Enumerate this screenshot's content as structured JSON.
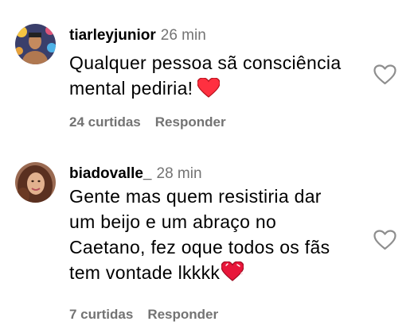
{
  "comments": [
    {
      "username": "tiarleyjunior",
      "time": "26 min",
      "text_lines": [
        "Qualquer pessoa sã consciência",
        "mental pediria!"
      ],
      "emoji": "red-heart-emoji",
      "likes": "24 curtidas",
      "reply": "Responder"
    },
    {
      "username": "biadovalle_",
      "time": "28 min",
      "text_lines": [
        "Gente mas quem resistiria dar",
        "um beijo e um abraço no",
        "Caetano, fez oque todos os fãs",
        "tem vontade lkkkk"
      ],
      "emoji": "sparkling-heart-emoji",
      "likes": "7 curtidas",
      "reply": "Responder"
    }
  ],
  "colors": {
    "secondary_text": "#737373",
    "heart_red": "#ff3040",
    "like_outline": "#8e8e8e"
  }
}
